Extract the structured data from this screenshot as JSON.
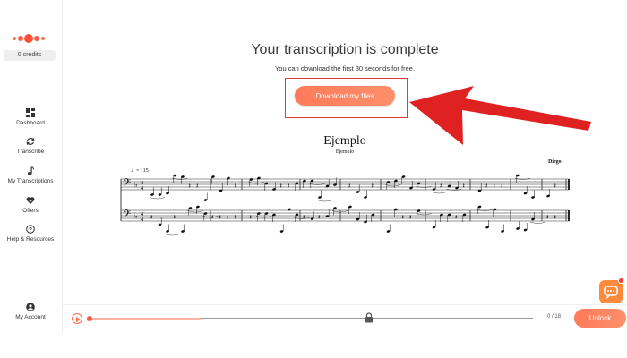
{
  "sidebar": {
    "credits": "0 credits",
    "items": [
      {
        "label": "Dashboard",
        "icon": "dashboard-icon"
      },
      {
        "label": "Transcribe",
        "icon": "refresh-icon"
      },
      {
        "label": "My Transcriptions",
        "icon": "music-note-icon"
      },
      {
        "label": "Offers",
        "icon": "gift-icon"
      },
      {
        "label": "Help & Resources",
        "icon": "question-icon"
      }
    ],
    "account": {
      "label": "My Account",
      "icon": "user-icon"
    }
  },
  "main": {
    "headline": "Your transcription is complete",
    "subline": "You can download the first 30 seconds for free.",
    "download_label": "Download my files"
  },
  "score": {
    "title": "Ejemplo",
    "subtitle": "Ejemplo",
    "composer": "Diego",
    "tempo": "♩= 115"
  },
  "player": {
    "time": "0 / 18",
    "progress": 0,
    "free_fraction": 0.25,
    "unlock_label": "Unlock"
  },
  "colors": {
    "accent": "#ff7a59",
    "highlight": "#e53935"
  }
}
